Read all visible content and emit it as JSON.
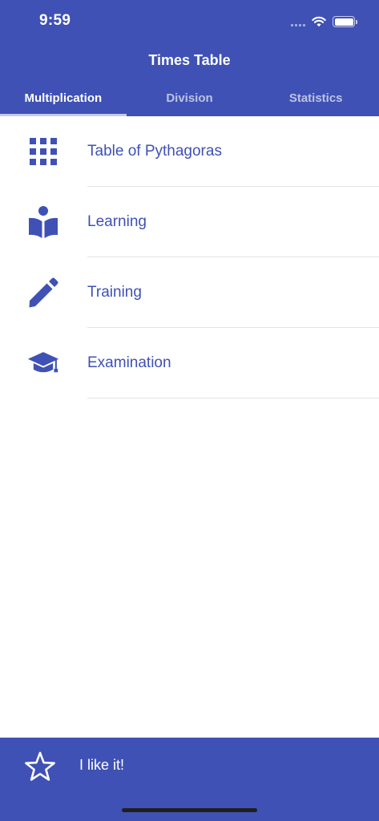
{
  "status_bar": {
    "time": "9:59",
    "icons": [
      "signal-icon",
      "wifi-icon",
      "battery-icon"
    ]
  },
  "app": {
    "title": "Times Table"
  },
  "tabs": [
    {
      "label": "Multiplication",
      "active": true
    },
    {
      "label": "Division",
      "active": false
    },
    {
      "label": "Statistics",
      "active": false
    }
  ],
  "menu": {
    "items": [
      {
        "label": "Table of Pythagoras",
        "icon": "grid-icon"
      },
      {
        "label": "Learning",
        "icon": "reader-book-icon"
      },
      {
        "label": "Training",
        "icon": "pencil-icon"
      },
      {
        "label": "Examination",
        "icon": "graduation-cap-icon"
      }
    ]
  },
  "bottom_bar": {
    "label": "I like it!",
    "icon": "star-outline-icon"
  },
  "colors": {
    "primary": "#3f51b5",
    "tab_indicator": "#c5cae9",
    "divider": "#e3e3e3",
    "background": "#ffffff"
  }
}
